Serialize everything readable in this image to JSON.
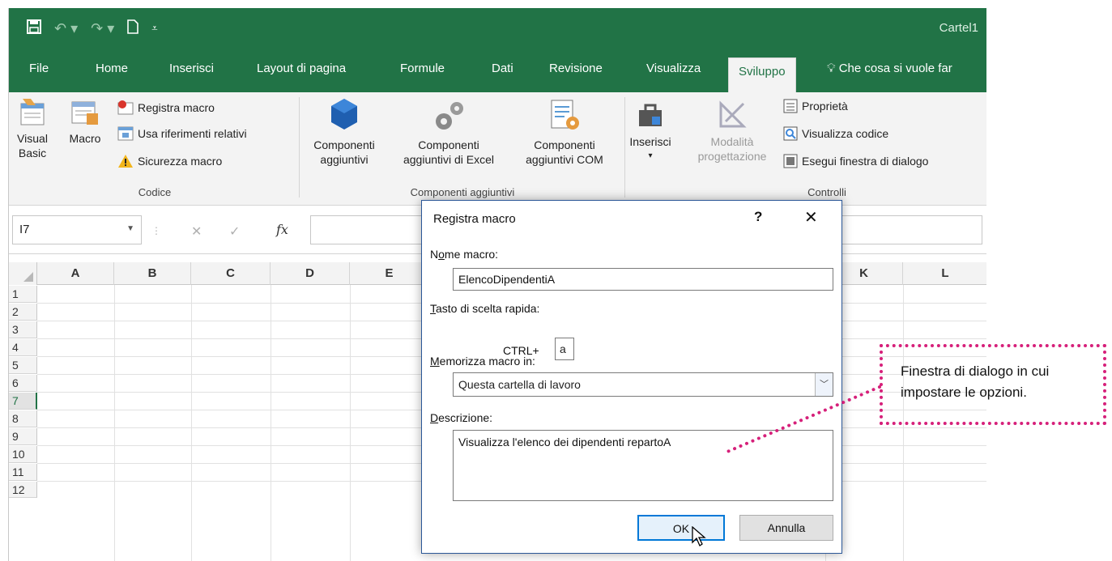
{
  "window": {
    "title": "Cartel1",
    "qat": [
      "save-icon",
      "undo-icon",
      "redo-icon",
      "new-file-icon",
      "customize-qat-icon"
    ]
  },
  "tabs": [
    {
      "label": "File"
    },
    {
      "label": "Home"
    },
    {
      "label": "Inserisci"
    },
    {
      "label": "Layout di pagina"
    },
    {
      "label": "Formule"
    },
    {
      "label": "Dati"
    },
    {
      "label": "Revisione"
    },
    {
      "label": "Visualizza"
    },
    {
      "label": "Sviluppo",
      "active": true
    }
  ],
  "tell_me": "Che cosa si vuole far",
  "ribbon": {
    "codice": {
      "label": "Codice",
      "visual_basic": "Visual\nBasic",
      "macro": "Macro",
      "registra_macro": "Registra macro",
      "usa_riferimenti": "Usa riferimenti relativi",
      "sicurezza_macro": "Sicurezza macro"
    },
    "componenti": {
      "label": "Componenti aggiuntivi",
      "btn1": "Componenti\naggiuntivi",
      "btn2": "Componenti\naggiuntivi di Excel",
      "btn3": "Componenti\naggiuntivi COM"
    },
    "controlli": {
      "label": "Controlli",
      "inserisci": "Inserisci",
      "modalita": "Modalità\nprogettazione",
      "proprieta": "Proprietà",
      "visualizza_codice": "Visualizza codice",
      "esegui_finestra": "Esegui finestra di dialogo"
    }
  },
  "formula_bar": {
    "name_box": "I7",
    "cancel": "✕",
    "enter": "✓",
    "fx": "fx"
  },
  "grid": {
    "columns": [
      "A",
      "B",
      "C",
      "D",
      "E",
      "K",
      "L"
    ],
    "rows": [
      "1",
      "2",
      "3",
      "4",
      "5",
      "6",
      "7",
      "8",
      "9",
      "10",
      "11",
      "12"
    ],
    "selected_row": "7"
  },
  "dialog": {
    "title": "Registra macro",
    "help": "?",
    "close": "✕",
    "name_label_pre": "N",
    "name_label_ul": "o",
    "name_label_post": "me macro:",
    "name_value": "ElencoDipendentiA",
    "shortcut_label_ul": "T",
    "shortcut_label_post": "asto di scelta rapida:",
    "shortcut_prefix": "CTRL+",
    "shortcut_key": "a",
    "store_label_ul": "M",
    "store_label_post": "emorizza macro in:",
    "store_value": "Questa cartella di lavoro",
    "desc_label_ul": "D",
    "desc_label_post": "escrizione:",
    "desc_value": "Visualizza l'elenco dei dipendenti repartoA",
    "ok": "OK",
    "cancel": "Annulla"
  },
  "callout": {
    "text": "Finestra di dialogo in cui impostare le opzioni.",
    "color": "#d6207a"
  },
  "colors": {
    "excel_green": "#217346",
    "dialog_border": "#2b5797",
    "ok_border": "#0078d7"
  }
}
